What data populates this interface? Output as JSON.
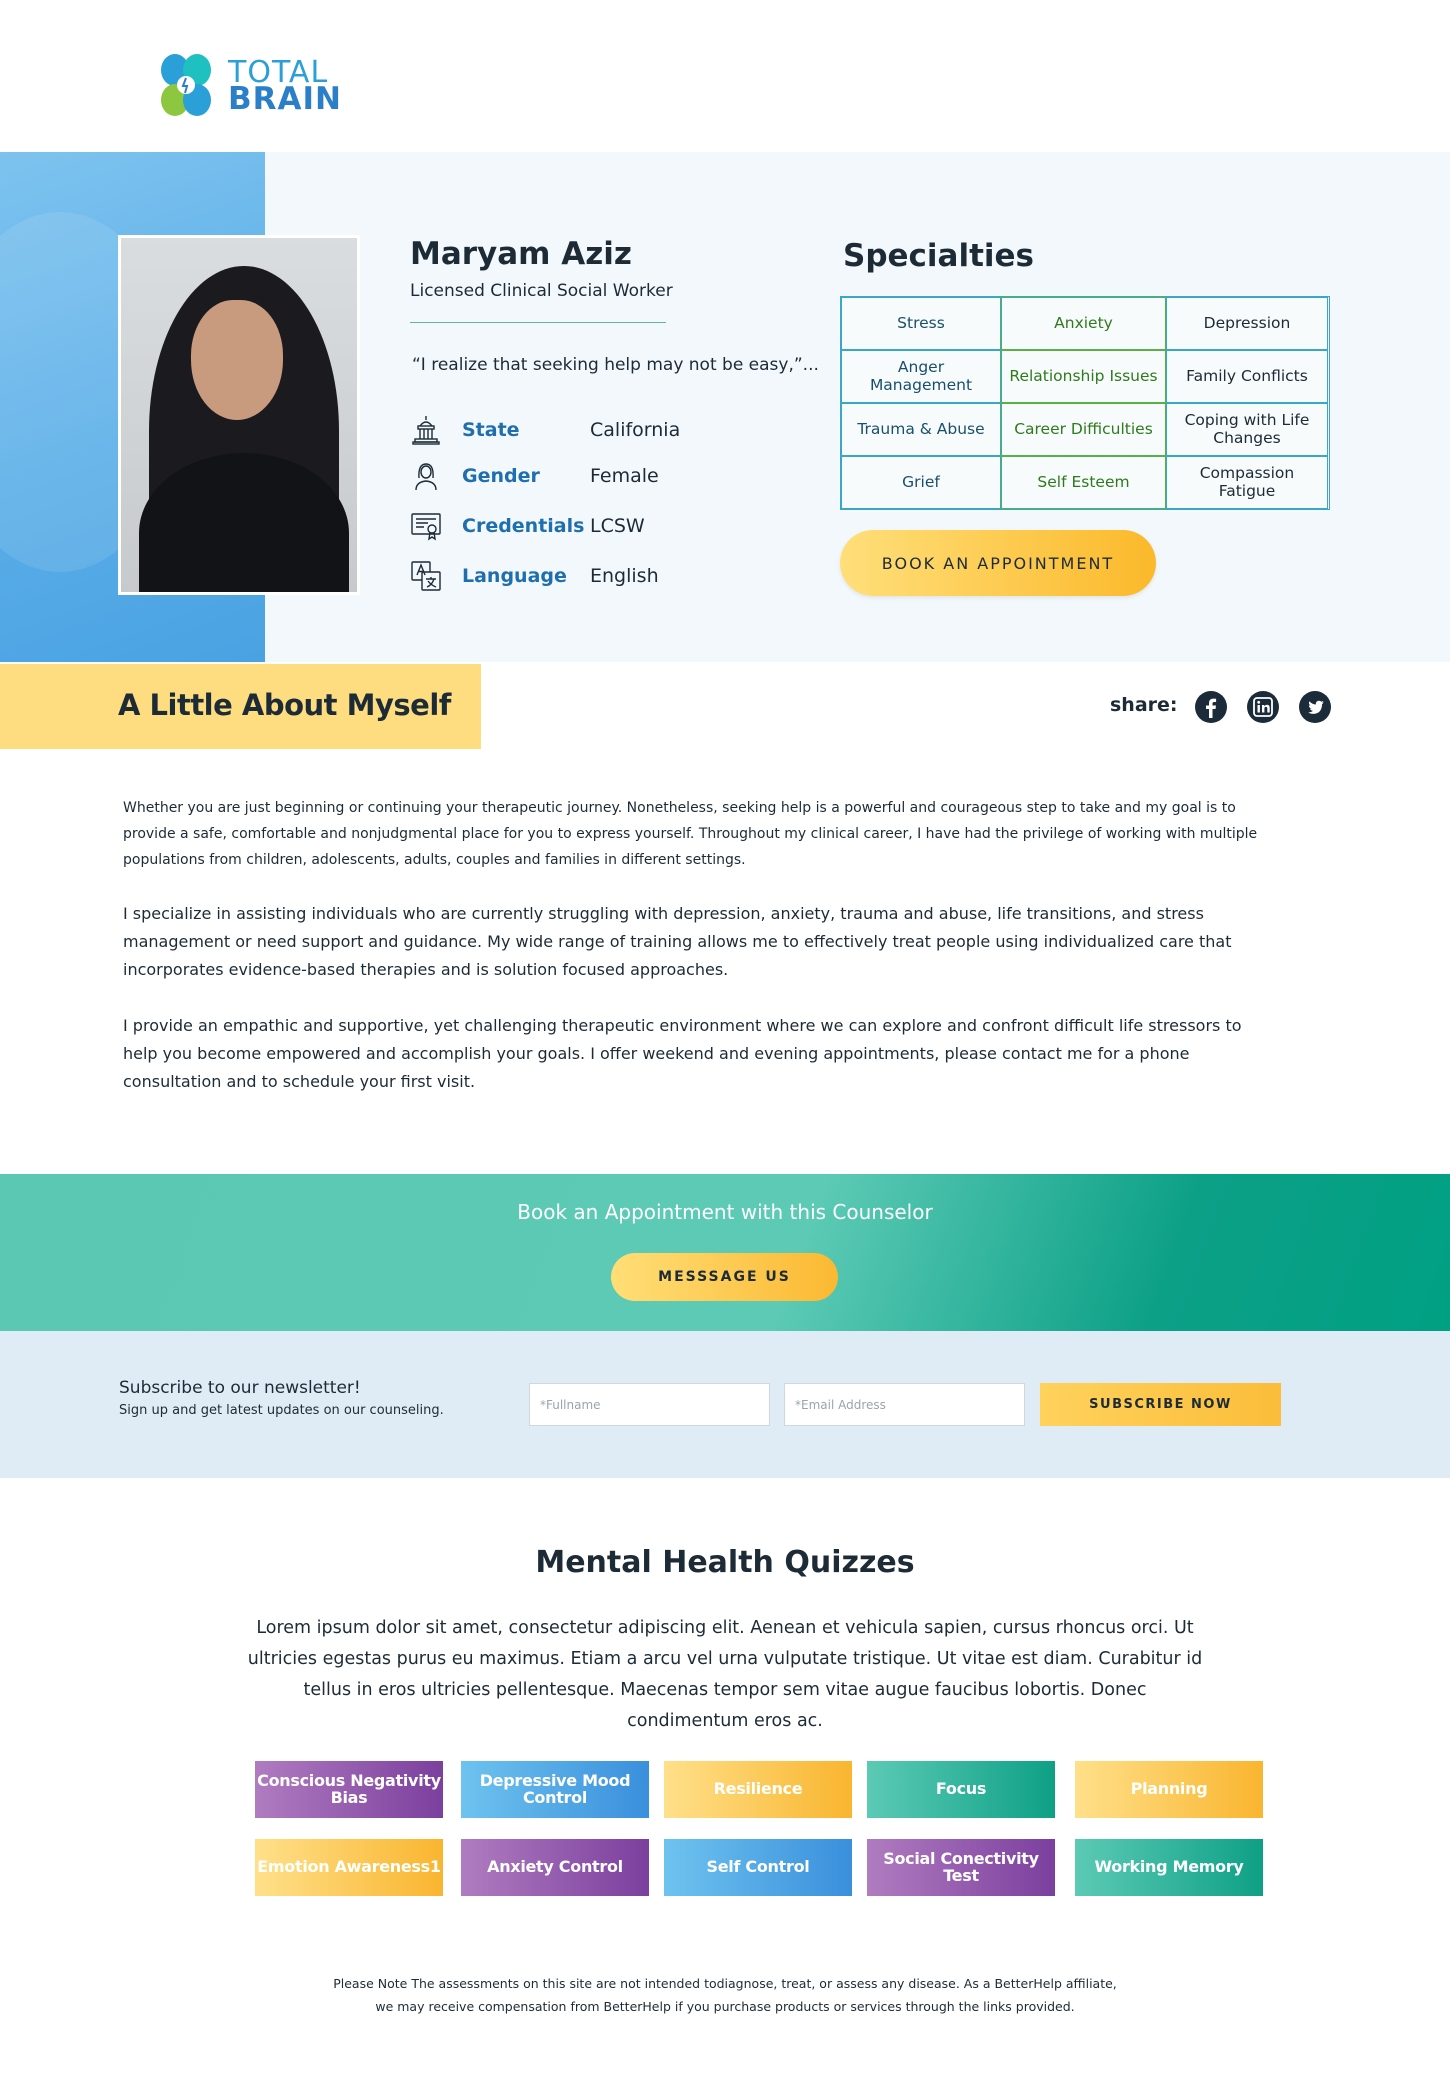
{
  "brand": {
    "logo_line1": "TOTAL",
    "logo_line2": "BRAIN"
  },
  "profile": {
    "name": "Maryam Aziz",
    "title": "Licensed Clinical Social Worker",
    "quote": "“I realize that seeking help may not be easy,”...",
    "info": [
      {
        "label": "State",
        "value": "California",
        "icon": "capitol-building-icon"
      },
      {
        "label": "Gender",
        "value": "Female",
        "icon": "person-icon"
      },
      {
        "label": "Credentials",
        "value": "LCSW",
        "icon": "certificate-icon"
      },
      {
        "label": "Language",
        "value": "English",
        "icon": "translate-icon"
      }
    ]
  },
  "specialties": {
    "title": "Specialties",
    "items": [
      "Stress",
      "Anxiety",
      "Depression",
      "Anger Management",
      "Relationship Issues",
      "Family Conflicts",
      "Trauma & Abuse",
      "Career Difficulties",
      "Coping with Life Changes",
      "Grief",
      "Self Esteem",
      "Compassion Fatigue"
    ],
    "book_button": "BOOK AN APPOINTMENT"
  },
  "about": {
    "title": "A Little About Myself",
    "share_label": "share:",
    "paragraphs": [
      "Whether you are just beginning or continuing your therapeutic journey. Nonetheless, seeking help is a powerful and courageous step to take and my goal is to provide a safe, comfortable and nonjudgmental place for you to express yourself. Throughout my clinical career, I have had the privilege of working with multiple populations from children, adolescents, adults, couples and families in different settings.",
      "I specialize in assisting individuals who are currently struggling with depression, anxiety, trauma and abuse, life transitions, and stress management or need support and guidance. My wide range of training allows me to effectively treat people using individualized care that incorporates evidence-based therapies and is solution focused approaches.",
      "I provide an empathic and supportive, yet challenging therapeutic environment where we can explore and confront difficult life stressors to help you become empowered and accomplish your goals. I offer weekend and evening appointments, please contact me for a phone consultation and to schedule your first visit."
    ]
  },
  "booking_band": {
    "text": "Book an Appointment with this Counselor",
    "button": "MESSSAGE US"
  },
  "newsletter": {
    "title": "Subscribe to our newsletter!",
    "subtitle": "Sign up and get latest updates on our counseling.",
    "fullname_placeholder": "*Fullname",
    "email_placeholder": "*Email Address",
    "button": "SUBSCRIBE NOW"
  },
  "quizzes": {
    "title": "Mental Health Quizzes",
    "description": "Lorem ipsum dolor sit amet, consectetur adipiscing elit. Aenean et vehicula sapien, cursus rhoncus orci. Ut ultricies egestas purus eu maximus. Etiam a arcu vel urna vulputate tristique. Ut vitae est diam. Curabitur id tellus in eros ultricies pellentesque. Maecenas tempor sem vitae augue faucibus lobortis. Donec condimentum eros ac.",
    "items": [
      "Conscious Negativity Bias",
      "Depressive Mood Control",
      "Resilience",
      "Focus",
      "Planning",
      "Emotion Awareness1",
      "Anxiety Control",
      "Self Control",
      "Social Conectivity Test",
      "Working Memory"
    ]
  },
  "disclaimer": [
    "Please Note The assessments on this site are not intended todiagnose, treat, or assess any disease. As a BetterHelp affiliate,",
    "we may receive compensation from BetterHelp if you purchase products or services through the links provided."
  ],
  "colors": {
    "navy": "#1d2b36",
    "label_blue": "#1f6fae",
    "teal": "#5ccab5",
    "yellow": "#fbb92b",
    "about_banner": "#fedc80",
    "newsletter_bg": "#dfecf5"
  }
}
